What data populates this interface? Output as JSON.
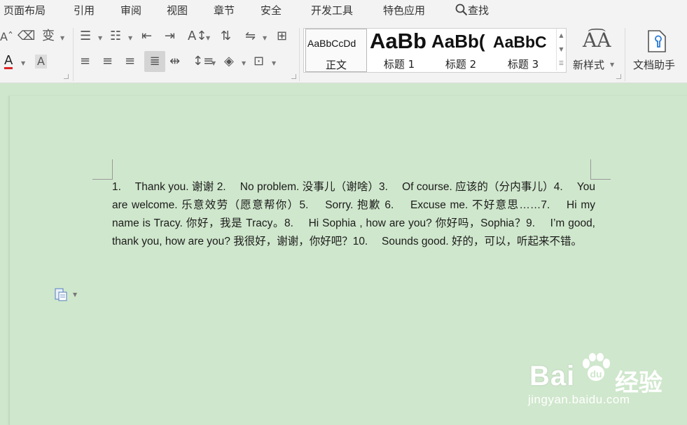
{
  "menu": {
    "items": [
      "页面布局",
      "引用",
      "审阅",
      "视图",
      "章节",
      "安全",
      "开发工具",
      "特色应用"
    ],
    "search_label": "查找"
  },
  "ribbon": {
    "styles": {
      "normal_sample": "AaBbCcDd",
      "normal_label": "正文",
      "h1_sample": "AaBb",
      "h1_label": "标题 1",
      "h2_sample": "AaBb(",
      "h2_label": "标题 2",
      "h3_sample": "AaBbC",
      "h3_label": "标题 3"
    },
    "new_style_label": "新样式",
    "doc_helper_label": "文档助手",
    "font_color_glyph": "A",
    "highlight_glyph": "A"
  },
  "document": {
    "text": "1.　 Thank you. 谢谢 2.　 No problem. 没事儿（谢啥）3.　 Of course. 应该的（分内事儿）4.　 You are welcome. 乐意效劳（愿意帮你）5.　 Sorry. 抱歉 6.　 Excuse me. 不好意思……7.　 Hi my name is Tracy. 你好，我是 Tracy。8.　 Hi Sophia , how are you? 你好吗，Sophia？9.　 I’m good, thank you, how are you? 我很好，谢谢，你好吧？10.　 Sounds good. 好的，可以，听起来不错。"
  },
  "watermark": {
    "logo": "Bai",
    "logo_cn": "经验",
    "url": "jingyan.baidu.com"
  },
  "colors": {
    "background": "#cfe7cc",
    "toolbar": "#f3f3f3",
    "font_color_red": "#d22"
  },
  "icons": [
    "search-icon",
    "eraser-icon",
    "phonetic-icon",
    "bullet-list-icon",
    "numbered-list-icon",
    "decrease-indent-icon",
    "increase-indent-icon",
    "char-scale-icon",
    "sort-icon",
    "line-spacing-icon",
    "table-icon",
    "align-left-icon",
    "align-center-icon",
    "align-right-icon",
    "justify-icon",
    "distributed-icon",
    "paragraph-spacing-icon",
    "shading-icon",
    "border-icon",
    "new-style-icon",
    "doc-helper-icon",
    "paste-options-icon"
  ]
}
